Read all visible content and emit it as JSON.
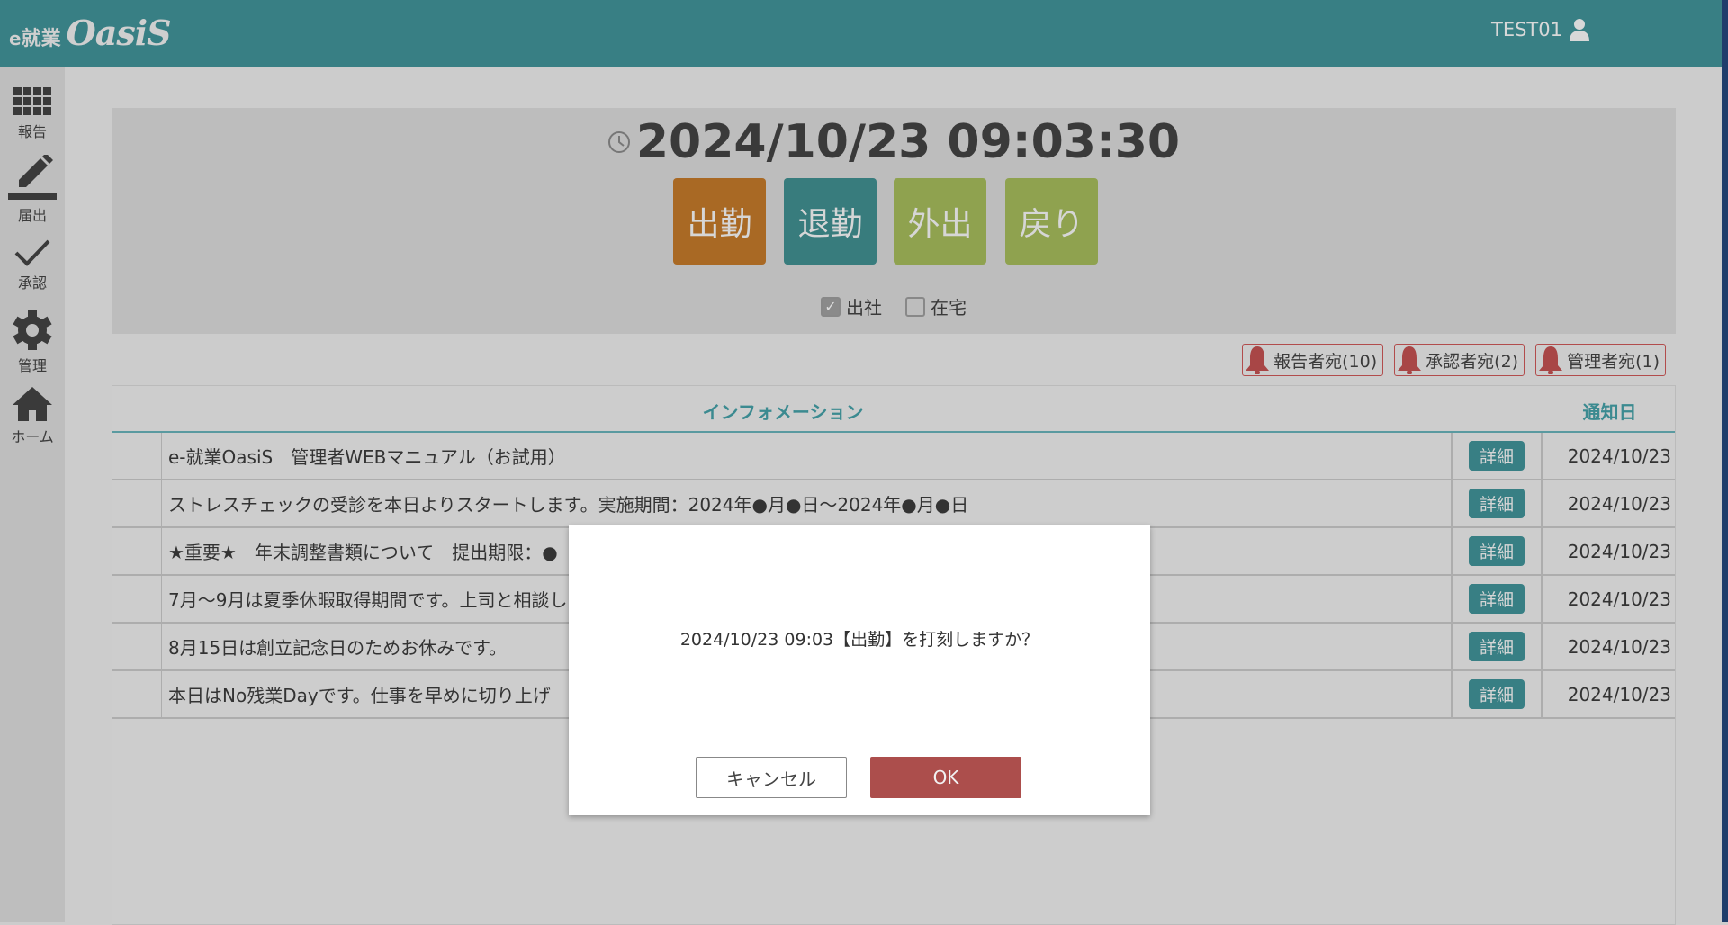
{
  "header": {
    "logo_e": "e",
    "logo_jp": "就業",
    "logo_name": "OasiS",
    "user": "TEST01"
  },
  "sidebar": {
    "items": [
      {
        "label": "報告",
        "icon": "grid-icon"
      },
      {
        "label": "届出",
        "icon": "pencil-icon"
      },
      {
        "label": "承認",
        "icon": "check-icon"
      },
      {
        "label": "管理",
        "icon": "gear-icon"
      },
      {
        "label": "ホーム",
        "icon": "home-icon"
      }
    ]
  },
  "clock": {
    "datetime": "2024/10/23 09:03:30"
  },
  "punch_buttons": [
    {
      "label": "出勤",
      "color": "#a96924"
    },
    {
      "label": "退勤",
      "color": "#387c7d"
    },
    {
      "label": "外出",
      "color": "#8fa24f"
    },
    {
      "label": "戻り",
      "color": "#8fa24f"
    }
  ],
  "work_location": [
    {
      "label": "出社",
      "checked": true
    },
    {
      "label": "在宅",
      "checked": false
    }
  ],
  "badges": [
    {
      "label": "報告者宛(10)"
    },
    {
      "label": "承認者宛(2)"
    },
    {
      "label": "管理者宛(1)"
    }
  ],
  "table": {
    "headers": {
      "info": "インフォメーション",
      "date": "通知日"
    },
    "detail_label": "詳細",
    "rows": [
      {
        "text": "e-就業OasiS　管理者WEBマニュアル（お試用）",
        "date": "2024/10/23"
      },
      {
        "text": "ストレスチェックの受診を本日よりスタートします。実施期間：2024年●月●日～2024年●月●日",
        "date": "2024/10/23"
      },
      {
        "text": "★重要★　年末調整書類について　提出期限：●",
        "date": "2024/10/23"
      },
      {
        "text": "7月～9月は夏季休暇取得期間です。上司と相談し",
        "date": "2024/10/23"
      },
      {
        "text": "8月15日は創立記念日のためお休みです。",
        "date": "2024/10/23"
      },
      {
        "text": "本日はNo残業Dayです。仕事を早めに切り上げ",
        "date": "2024/10/23"
      }
    ]
  },
  "dialog": {
    "message": "2024/10/23 09:03【出勤】を打刻しますか？",
    "cancel": "キャンセル",
    "ok": "OK"
  }
}
